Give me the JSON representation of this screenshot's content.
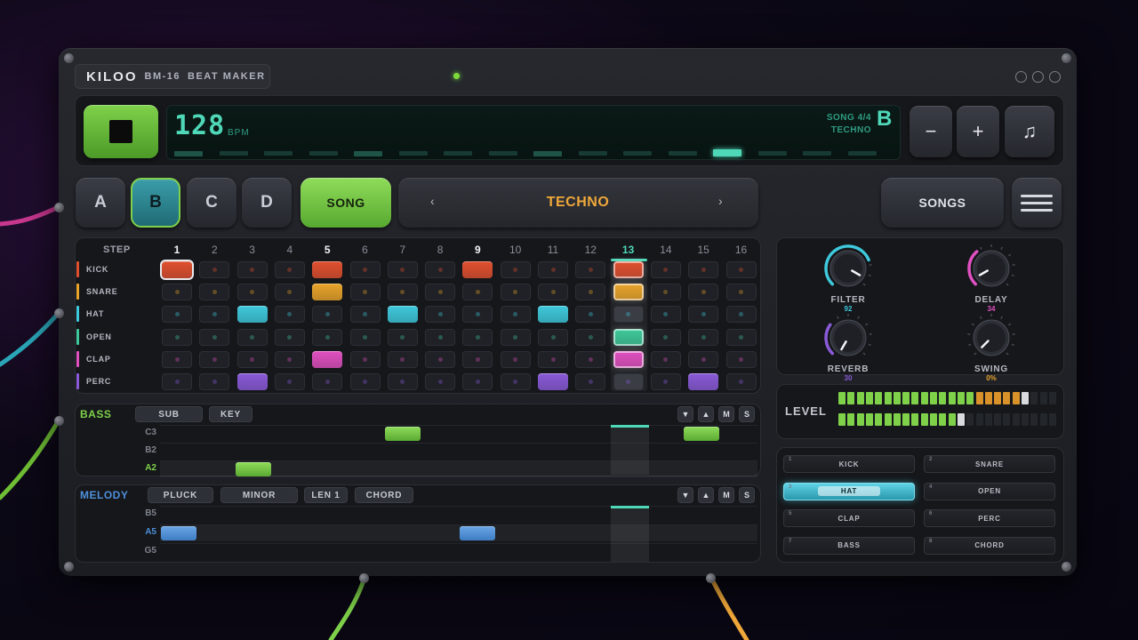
{
  "header": {
    "brand": "KILOO",
    "model": "BM-16",
    "subtitle": "BEAT MAKER"
  },
  "transport": {
    "bpm": "128",
    "bpm_unit": "BPM",
    "song_line": "SONG 4/4",
    "genre_line": "TECHNO",
    "pattern": "B",
    "minus_label": "−",
    "plus_label": "+",
    "metronome_label": "♫",
    "progress_active_step": 13
  },
  "patterns": {
    "items": [
      "A",
      "B",
      "C",
      "D"
    ],
    "active": "B"
  },
  "song_button": "SONG",
  "genre": {
    "prev": "‹",
    "name": "TECHNO",
    "next": "›"
  },
  "songs_button": "SONGS",
  "sequencer": {
    "header": "STEP",
    "steps": [
      "1",
      "2",
      "3",
      "4",
      "5",
      "6",
      "7",
      "8",
      "9",
      "10",
      "11",
      "12",
      "13",
      "14",
      "15",
      "16"
    ],
    "current_step": 13,
    "tracks": [
      {
        "name": "KICK",
        "color": "#e0502f",
        "on": [
          1,
          5,
          9,
          13
        ],
        "selected": 1
      },
      {
        "name": "SNARE",
        "color": "#e9a42a",
        "on": [
          5,
          13
        ]
      },
      {
        "name": "HAT",
        "color": "#3ec9dc",
        "on": [
          3,
          7,
          11
        ]
      },
      {
        "name": "OPEN",
        "color": "#3ec99a",
        "on": [
          13
        ]
      },
      {
        "name": "CLAP",
        "color": "#e050c0",
        "on": [
          5,
          13
        ]
      },
      {
        "name": "PERC",
        "color": "#8a5ad8",
        "on": [
          3,
          11,
          15
        ]
      }
    ]
  },
  "knobs": [
    {
      "label": "FILTER",
      "value": "92",
      "color": "#3ec9dc"
    },
    {
      "label": "DELAY",
      "value": "34",
      "color": "#e050c0"
    },
    {
      "label": "REVERB",
      "value": "30",
      "color": "#8a5ad8"
    },
    {
      "label": "SWING",
      "value": "0%",
      "color": "#e9a42a"
    }
  ],
  "level": {
    "label": "LEVEL",
    "left_percent": 83,
    "right_percent": 55
  },
  "bass": {
    "title": "BASS",
    "chips": [
      "SUB",
      "KEY"
    ],
    "controls": [
      "▼",
      "▲",
      "M",
      "S"
    ],
    "rows": [
      "C3",
      "B2",
      "A2"
    ],
    "active_row": "A2",
    "notes": [
      {
        "row": "C3",
        "start": 7,
        "length": 1
      },
      {
        "row": "C3",
        "start": 15,
        "length": 1
      },
      {
        "row": "A2",
        "start": 3,
        "length": 1
      }
    ]
  },
  "melody": {
    "title": "MELODY",
    "chips": [
      "PLUCK",
      "MINOR",
      "LEN 1",
      "CHORD"
    ],
    "controls": [
      "▼",
      "▲",
      "M",
      "S"
    ],
    "rows": [
      "B5",
      "A5",
      "G5"
    ],
    "active_row": "A5",
    "notes": [
      {
        "row": "A5",
        "start": 1,
        "length": 1
      },
      {
        "row": "A5",
        "start": 9,
        "length": 1
      }
    ]
  },
  "slots": [
    {
      "idx": "1",
      "label": "KICK"
    },
    {
      "idx": "2",
      "label": "SNARE"
    },
    {
      "idx": "3",
      "label": "HAT",
      "active": true
    },
    {
      "idx": "4",
      "label": "OPEN"
    },
    {
      "idx": "5",
      "label": "CLAP"
    },
    {
      "idx": "6",
      "label": "PERC"
    },
    {
      "idx": "7",
      "label": "BASS"
    },
    {
      "idx": "8",
      "label": "CHORD"
    }
  ],
  "colors": {
    "accent": "#4fd8b8",
    "green": "#7fd14a",
    "orange": "#f0a83a",
    "blue": "#4f8fd8"
  }
}
